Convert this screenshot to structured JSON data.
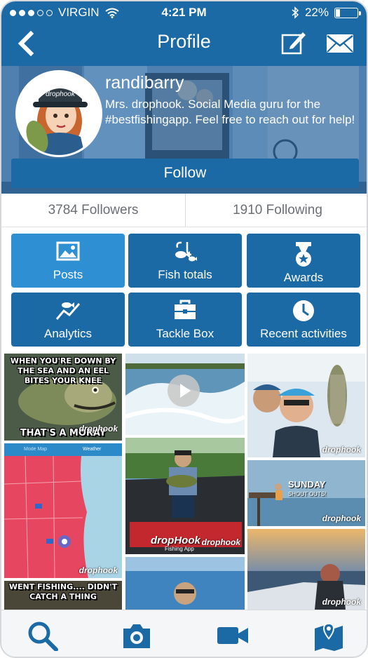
{
  "status_bar": {
    "carrier": "VIRGIN",
    "time": "4:21 PM",
    "battery": "22%",
    "battery_level": 0.22
  },
  "nav": {
    "title": "Profile",
    "back_icon": "chevron-left-icon",
    "edit_icon": "compose-icon",
    "mail_icon": "envelope-icon"
  },
  "profile": {
    "username": "randibarry",
    "bio": "Mrs. drophook. Social Media guru for the #bestfishingapp. Feel free to reach out for help!",
    "avatar_logo": "drophook",
    "follow_label": "Follow"
  },
  "stats": {
    "followers": "3784 Followers",
    "following": "1910 Following"
  },
  "menu": [
    {
      "label": "Posts",
      "icon": "image-icon",
      "active": true
    },
    {
      "label": "Fish totals",
      "icon": "fish-hook-icon",
      "active": false
    },
    {
      "label": "Awards",
      "icon": "medal-icon",
      "active": false
    },
    {
      "label": "Analytics",
      "icon": "chart-fish-icon",
      "active": false
    },
    {
      "label": "Tackle Box",
      "icon": "toolbox-icon",
      "active": false
    },
    {
      "label": "Recent activities",
      "icon": "clock-icon",
      "active": false
    }
  ],
  "photos": {
    "meme_top": "WHEN YOU'RE DOWN BY THE SEA AND AN EEL BITES YOUR KNEE",
    "meme_bottom": "THAT'S A MORAY",
    "meme2": "WENT FISHING.... DIDN'T CATCH A THING",
    "map_tab_left": "Mode Map",
    "map_tab_right": "Weather",
    "sunday_title": "SUNDAY",
    "sunday_sub": "SHOUT OUTS!",
    "watermark": "drophook",
    "banner_text": "dropHook",
    "banner_sub": "Fishing App"
  },
  "tabbar": [
    {
      "name": "search",
      "icon": "search-icon"
    },
    {
      "name": "camera",
      "icon": "camera-icon"
    },
    {
      "name": "video",
      "icon": "video-icon"
    },
    {
      "name": "map",
      "icon": "map-pin-icon"
    }
  ],
  "colors": {
    "brand_blue": "#1b6aa5",
    "active_tile": "#2e8fd3",
    "count_text": "#6b6f74"
  }
}
